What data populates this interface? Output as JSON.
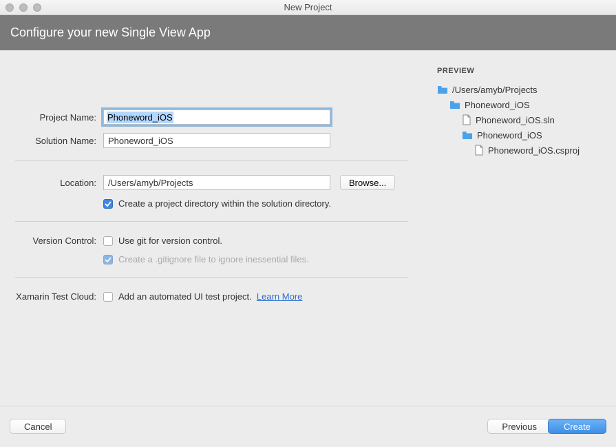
{
  "window": {
    "title": "New Project"
  },
  "header": {
    "title": "Configure your new Single View App"
  },
  "form": {
    "project_name": {
      "label": "Project Name:",
      "value": "Phoneword_iOS"
    },
    "solution_name": {
      "label": "Solution Name:",
      "value": "Phoneword_iOS"
    },
    "location": {
      "label": "Location:",
      "value": "/Users/amyb/Projects",
      "browse": "Browse..."
    },
    "create_dir": {
      "label": "Create a project directory within the solution directory.",
      "checked": true
    },
    "version_control": {
      "label": "Version Control:",
      "use_git": {
        "label": "Use git for version control.",
        "checked": false
      },
      "gitignore": {
        "label": "Create a .gitignore file to ignore inessential files.",
        "checked": true,
        "disabled": true
      }
    },
    "test_cloud": {
      "label": "Xamarin Test Cloud:",
      "add_test": {
        "label": "Add an automated UI test project.",
        "checked": false
      },
      "learn_more": "Learn More"
    }
  },
  "preview": {
    "heading": "PREVIEW",
    "tree": {
      "root": "/Users/amyb/Projects",
      "l2": "Phoneword_iOS",
      "l3a": "Phoneword_iOS.sln",
      "l3b": "Phoneword_iOS",
      "l4": "Phoneword_iOS.csproj"
    }
  },
  "footer": {
    "cancel": "Cancel",
    "previous": "Previous",
    "create": "Create"
  }
}
